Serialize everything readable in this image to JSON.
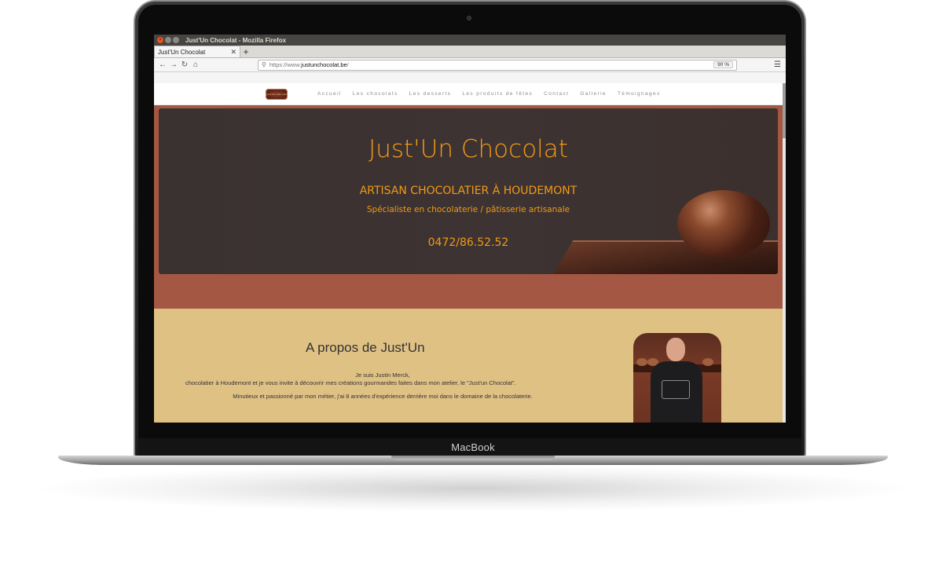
{
  "device": {
    "brand_label": "MacBook"
  },
  "browser": {
    "window_title": "Just'Un Chocolat - Mozilla Firefox",
    "tab_label": "Just'Un Chocolat",
    "url_scheme": "https://www.",
    "url_domain": "justunchocolat.be",
    "url_path": "/",
    "zoom": "90 %"
  },
  "site": {
    "logo_text": "Just'Un Chocolat",
    "menu": [
      "Accueil",
      "Les chocolats",
      "Les desserts",
      "Les produits de fêtes",
      "Contact",
      "Gallerie",
      "Témoignages"
    ],
    "hero": {
      "title": "Just'Un Chocolat",
      "subtitle": "ARTISAN CHOCOLATIER À HOUDEMONT",
      "tagline": "Spécialiste en chocolaterie / pâtisserie artisanale",
      "phone": "0472/86.52.52"
    },
    "about": {
      "title": "A propos de Just'Un",
      "line1": "Je suis Justin Merck,",
      "line2": "chocolatier à Houdemont et je vous invite à découvrir mes créations gourmandes faites dans mon atelier, le \"Just'un Chocolat\".",
      "line3": "Minutieux et passionné par mon métier, j'ai 8 années d'expérience derrière moi dans le domaine de la chocolaterie."
    }
  },
  "colors": {
    "accent_orange": "#f29a16",
    "hero_band": "#a45843",
    "about_bg": "#e0c184"
  }
}
